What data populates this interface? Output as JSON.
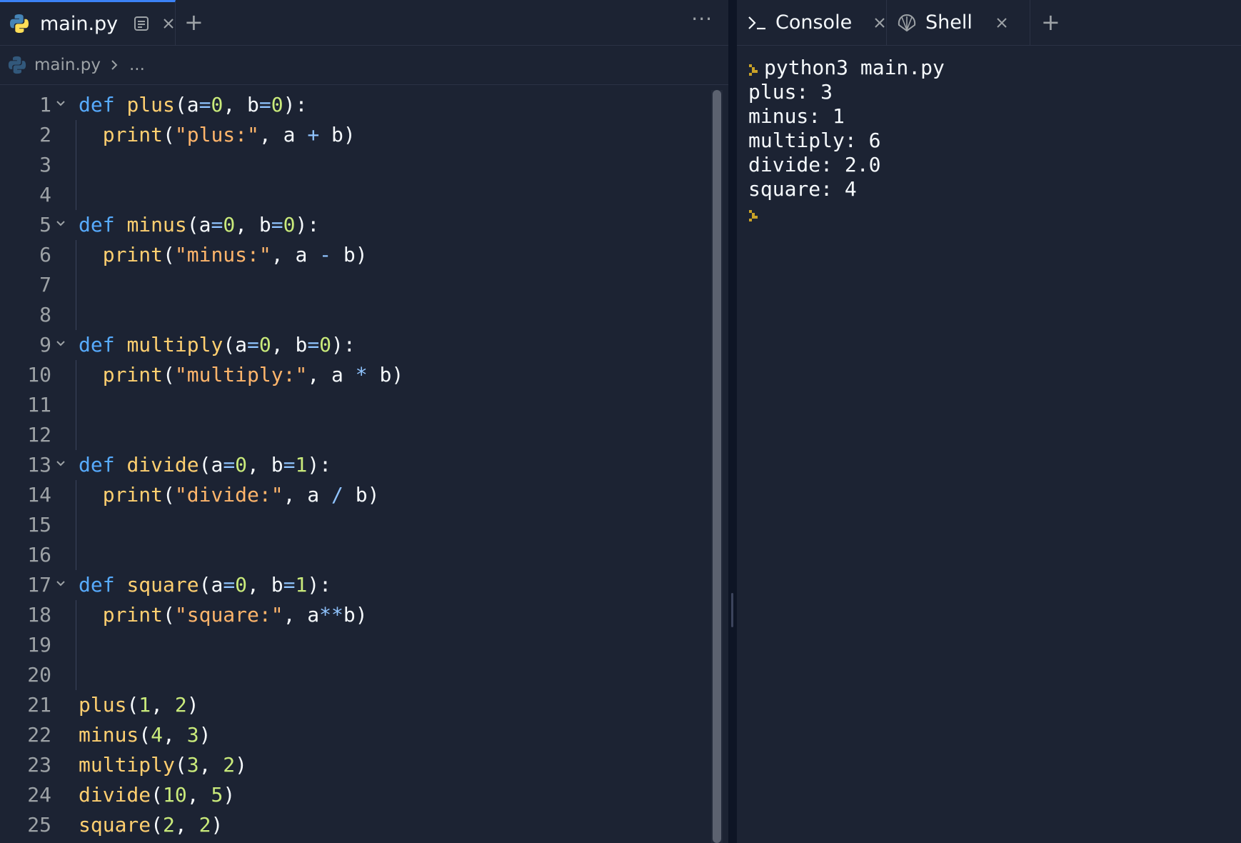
{
  "editor": {
    "active_tab": "main.py",
    "breadcrumb": {
      "file": "main.py",
      "rest": "..."
    },
    "more_label": "···",
    "plus_label": "+",
    "lines": [
      {
        "n": "1",
        "fold": true,
        "tokens": [
          {
            "t": "def",
            "c": "kw"
          },
          {
            "t": " ",
            "c": "pl"
          },
          {
            "t": "plus",
            "c": "fn"
          },
          {
            "t": "(",
            "c": "pl"
          },
          {
            "t": "a",
            "c": "pl"
          },
          {
            "t": "=",
            "c": "op"
          },
          {
            "t": "0",
            "c": "num"
          },
          {
            "t": ", b",
            "c": "pl"
          },
          {
            "t": "=",
            "c": "op"
          },
          {
            "t": "0",
            "c": "num"
          },
          {
            "t": "):",
            "c": "pl"
          }
        ]
      },
      {
        "n": "2",
        "indent": true,
        "tokens": [
          {
            "t": "  ",
            "c": "pl"
          },
          {
            "t": "print",
            "c": "fn"
          },
          {
            "t": "(",
            "c": "pl"
          },
          {
            "t": "\"plus:\"",
            "c": "str"
          },
          {
            "t": ", a ",
            "c": "pl"
          },
          {
            "t": "+",
            "c": "op"
          },
          {
            "t": " b)",
            "c": "pl"
          }
        ]
      },
      {
        "n": "3",
        "indent": true,
        "tokens": []
      },
      {
        "n": "4",
        "indent": true,
        "tokens": []
      },
      {
        "n": "5",
        "fold": true,
        "tokens": [
          {
            "t": "def",
            "c": "kw"
          },
          {
            "t": " ",
            "c": "pl"
          },
          {
            "t": "minus",
            "c": "fn"
          },
          {
            "t": "(",
            "c": "pl"
          },
          {
            "t": "a",
            "c": "pl"
          },
          {
            "t": "=",
            "c": "op"
          },
          {
            "t": "0",
            "c": "num"
          },
          {
            "t": ", b",
            "c": "pl"
          },
          {
            "t": "=",
            "c": "op"
          },
          {
            "t": "0",
            "c": "num"
          },
          {
            "t": "):",
            "c": "pl"
          }
        ]
      },
      {
        "n": "6",
        "indent": true,
        "tokens": [
          {
            "t": "  ",
            "c": "pl"
          },
          {
            "t": "print",
            "c": "fn"
          },
          {
            "t": "(",
            "c": "pl"
          },
          {
            "t": "\"minus:\"",
            "c": "str"
          },
          {
            "t": ", a ",
            "c": "pl"
          },
          {
            "t": "-",
            "c": "op"
          },
          {
            "t": " b)",
            "c": "pl"
          }
        ]
      },
      {
        "n": "7",
        "indent": true,
        "tokens": []
      },
      {
        "n": "8",
        "indent": true,
        "tokens": []
      },
      {
        "n": "9",
        "fold": true,
        "tokens": [
          {
            "t": "def",
            "c": "kw"
          },
          {
            "t": " ",
            "c": "pl"
          },
          {
            "t": "multiply",
            "c": "fn"
          },
          {
            "t": "(",
            "c": "pl"
          },
          {
            "t": "a",
            "c": "pl"
          },
          {
            "t": "=",
            "c": "op"
          },
          {
            "t": "0",
            "c": "num"
          },
          {
            "t": ", b",
            "c": "pl"
          },
          {
            "t": "=",
            "c": "op"
          },
          {
            "t": "0",
            "c": "num"
          },
          {
            "t": "):",
            "c": "pl"
          }
        ]
      },
      {
        "n": "10",
        "indent": true,
        "tokens": [
          {
            "t": "  ",
            "c": "pl"
          },
          {
            "t": "print",
            "c": "fn"
          },
          {
            "t": "(",
            "c": "pl"
          },
          {
            "t": "\"multiply:\"",
            "c": "str"
          },
          {
            "t": ", a ",
            "c": "pl"
          },
          {
            "t": "*",
            "c": "op"
          },
          {
            "t": " b)",
            "c": "pl"
          }
        ]
      },
      {
        "n": "11",
        "indent": true,
        "tokens": []
      },
      {
        "n": "12",
        "indent": true,
        "tokens": []
      },
      {
        "n": "13",
        "fold": true,
        "tokens": [
          {
            "t": "def",
            "c": "kw"
          },
          {
            "t": " ",
            "c": "pl"
          },
          {
            "t": "divide",
            "c": "fn"
          },
          {
            "t": "(",
            "c": "pl"
          },
          {
            "t": "a",
            "c": "pl"
          },
          {
            "t": "=",
            "c": "op"
          },
          {
            "t": "0",
            "c": "num"
          },
          {
            "t": ", b",
            "c": "pl"
          },
          {
            "t": "=",
            "c": "op"
          },
          {
            "t": "1",
            "c": "num"
          },
          {
            "t": "):",
            "c": "pl"
          }
        ]
      },
      {
        "n": "14",
        "indent": true,
        "tokens": [
          {
            "t": "  ",
            "c": "pl"
          },
          {
            "t": "print",
            "c": "fn"
          },
          {
            "t": "(",
            "c": "pl"
          },
          {
            "t": "\"divide:\"",
            "c": "str"
          },
          {
            "t": ", a ",
            "c": "pl"
          },
          {
            "t": "/",
            "c": "op"
          },
          {
            "t": " b)",
            "c": "pl"
          }
        ]
      },
      {
        "n": "15",
        "indent": true,
        "tokens": []
      },
      {
        "n": "16",
        "indent": true,
        "tokens": []
      },
      {
        "n": "17",
        "fold": true,
        "tokens": [
          {
            "t": "def",
            "c": "kw"
          },
          {
            "t": " ",
            "c": "pl"
          },
          {
            "t": "square",
            "c": "fn"
          },
          {
            "t": "(",
            "c": "pl"
          },
          {
            "t": "a",
            "c": "pl"
          },
          {
            "t": "=",
            "c": "op"
          },
          {
            "t": "0",
            "c": "num"
          },
          {
            "t": ", b",
            "c": "pl"
          },
          {
            "t": "=",
            "c": "op"
          },
          {
            "t": "1",
            "c": "num"
          },
          {
            "t": "):",
            "c": "pl"
          }
        ]
      },
      {
        "n": "18",
        "indent": true,
        "tokens": [
          {
            "t": "  ",
            "c": "pl"
          },
          {
            "t": "print",
            "c": "fn"
          },
          {
            "t": "(",
            "c": "pl"
          },
          {
            "t": "\"square:\"",
            "c": "str"
          },
          {
            "t": ", a",
            "c": "pl"
          },
          {
            "t": "**",
            "c": "op"
          },
          {
            "t": "b)",
            "c": "pl"
          }
        ]
      },
      {
        "n": "19",
        "indent": true,
        "tokens": []
      },
      {
        "n": "20",
        "indent": true,
        "tokens": []
      },
      {
        "n": "21",
        "tokens": [
          {
            "t": "plus",
            "c": "fn"
          },
          {
            "t": "(",
            "c": "pl"
          },
          {
            "t": "1",
            "c": "num"
          },
          {
            "t": ", ",
            "c": "pl"
          },
          {
            "t": "2",
            "c": "num"
          },
          {
            "t": ")",
            "c": "pl"
          }
        ]
      },
      {
        "n": "22",
        "tokens": [
          {
            "t": "minus",
            "c": "fn"
          },
          {
            "t": "(",
            "c": "pl"
          },
          {
            "t": "4",
            "c": "num"
          },
          {
            "t": ", ",
            "c": "pl"
          },
          {
            "t": "3",
            "c": "num"
          },
          {
            "t": ")",
            "c": "pl"
          }
        ]
      },
      {
        "n": "23",
        "tokens": [
          {
            "t": "multiply",
            "c": "fn"
          },
          {
            "t": "(",
            "c": "pl"
          },
          {
            "t": "3",
            "c": "num"
          },
          {
            "t": ", ",
            "c": "pl"
          },
          {
            "t": "2",
            "c": "num"
          },
          {
            "t": ")",
            "c": "pl"
          }
        ]
      },
      {
        "n": "24",
        "tokens": [
          {
            "t": "divide",
            "c": "fn"
          },
          {
            "t": "(",
            "c": "pl"
          },
          {
            "t": "10",
            "c": "num"
          },
          {
            "t": ", ",
            "c": "pl"
          },
          {
            "t": "5",
            "c": "num"
          },
          {
            "t": ")",
            "c": "pl"
          }
        ]
      },
      {
        "n": "25",
        "tokens": [
          {
            "t": "square",
            "c": "fn"
          },
          {
            "t": "(",
            "c": "pl"
          },
          {
            "t": "2",
            "c": "num"
          },
          {
            "t": ", ",
            "c": "pl"
          },
          {
            "t": "2",
            "c": "num"
          },
          {
            "t": ")",
            "c": "pl"
          }
        ]
      }
    ]
  },
  "console": {
    "tabs": [
      {
        "icon": "terminal-icon",
        "label": "Console"
      },
      {
        "icon": "shell-icon",
        "label": "Shell"
      }
    ],
    "plus_label": "+",
    "output": [
      {
        "prompt": true,
        "text": "python3 main.py"
      },
      {
        "prompt": false,
        "text": "plus: 3"
      },
      {
        "prompt": false,
        "text": "minus: 1"
      },
      {
        "prompt": false,
        "text": "multiply: 6"
      },
      {
        "prompt": false,
        "text": "divide: 2.0"
      },
      {
        "prompt": false,
        "text": "square: 4"
      },
      {
        "prompt": true,
        "text": ""
      }
    ]
  },
  "colors": {
    "background": "#1c2333",
    "accent": "#3b82f6",
    "keyword": "#57abff",
    "function": "#ffcf70",
    "string": "#ffb56b",
    "number": "#c9ea7b",
    "prompt": "#c9a227"
  }
}
